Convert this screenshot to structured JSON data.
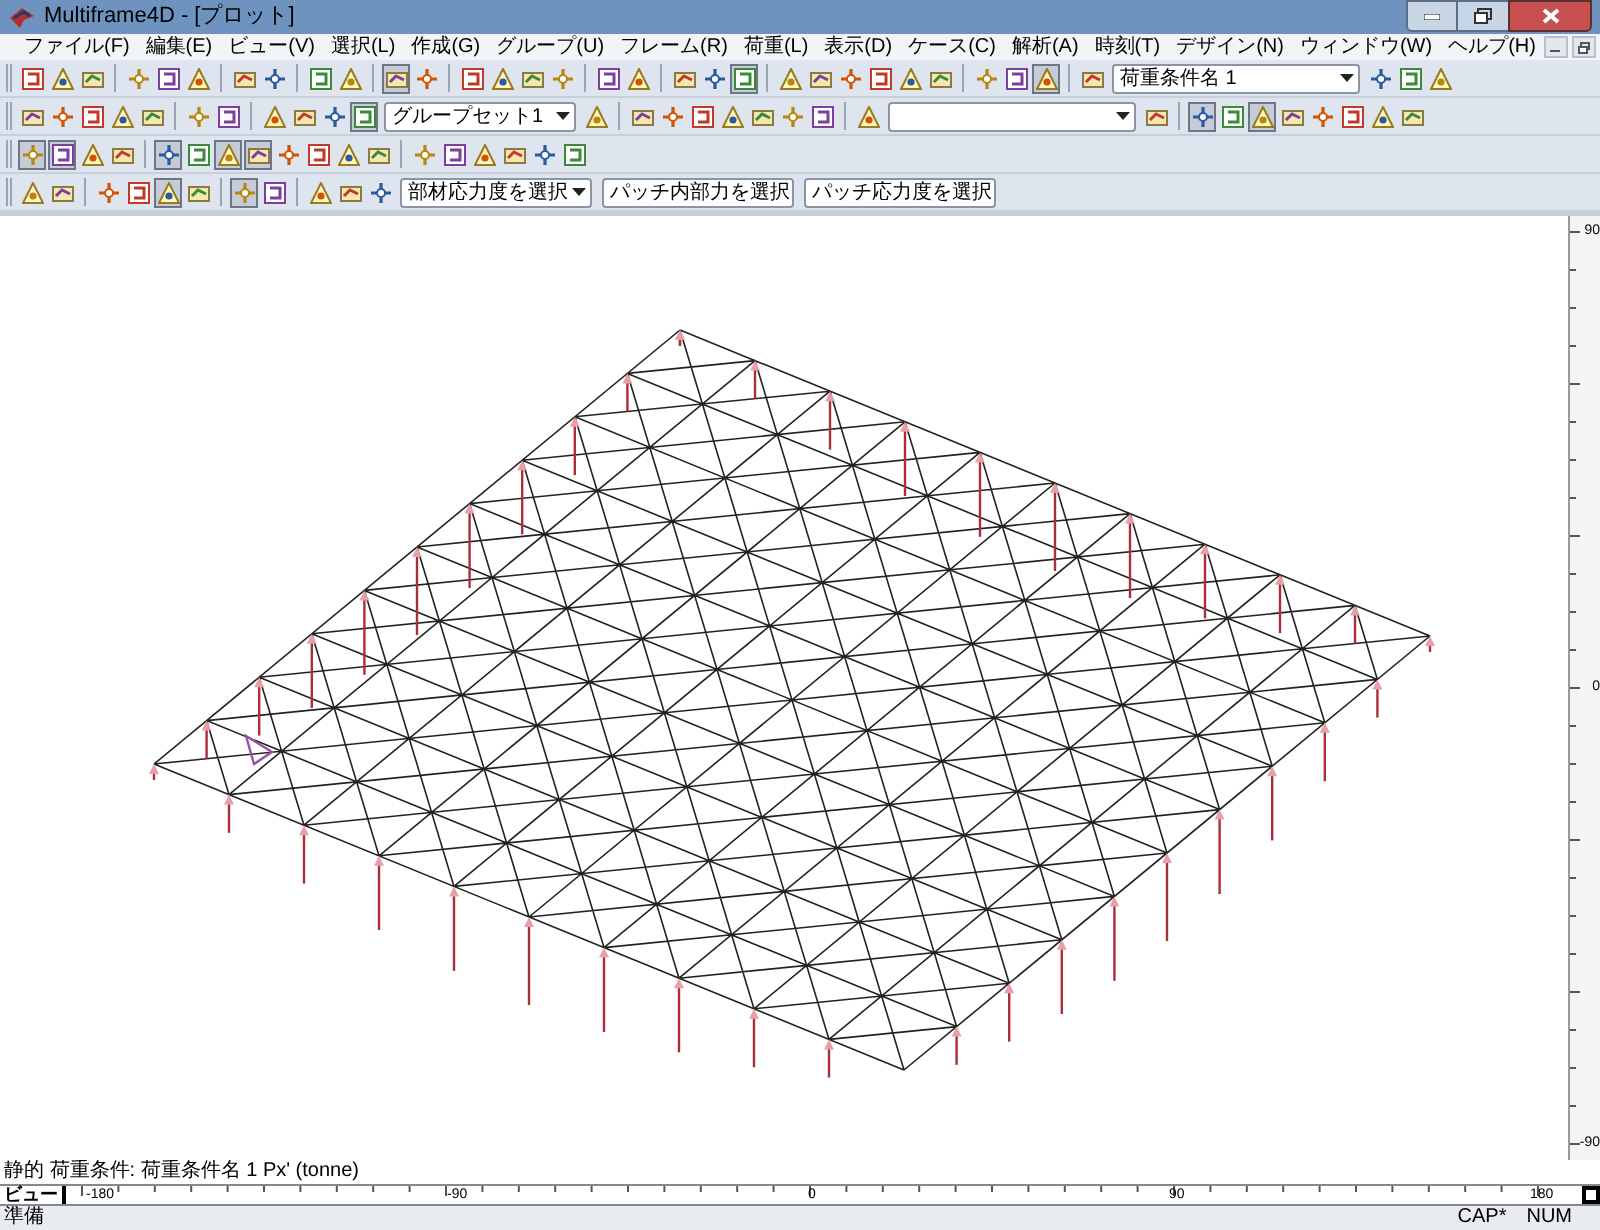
{
  "window": {
    "title": "Multiframe4D - [プロット]"
  },
  "menu": [
    "ファイル(F)",
    "編集(E)",
    "ビュー(V)",
    "選択(L)",
    "作成(G)",
    "グループ(U)",
    "フレーム(R)",
    "荷重(L)",
    "表示(D)",
    "ケース(C)",
    "解析(A)",
    "時刻(T)",
    "デザイン(N)",
    "ウィンドウ(W)",
    "ヘルプ(H)"
  ],
  "toolbars": [
    [
      {
        "kind": "button",
        "pressed": false
      },
      {
        "kind": "button",
        "pressed": false
      },
      {
        "kind": "button",
        "pressed": false
      },
      {
        "kind": "sep"
      },
      {
        "kind": "button",
        "pressed": false
      },
      {
        "kind": "button",
        "pressed": false
      },
      {
        "kind": "button",
        "pressed": false
      },
      {
        "kind": "sep"
      },
      {
        "kind": "button",
        "pressed": false
      },
      {
        "kind": "button",
        "pressed": false
      },
      {
        "kind": "sep"
      },
      {
        "kind": "button",
        "pressed": false
      },
      {
        "kind": "button",
        "pressed": false
      },
      {
        "kind": "sep"
      },
      {
        "kind": "button",
        "pressed": true
      },
      {
        "kind": "button",
        "pressed": false
      },
      {
        "kind": "sep"
      },
      {
        "kind": "button",
        "pressed": false
      },
      {
        "kind": "button",
        "pressed": false
      },
      {
        "kind": "button",
        "pressed": false
      },
      {
        "kind": "button",
        "pressed": false
      },
      {
        "kind": "sep"
      },
      {
        "kind": "button",
        "pressed": false
      },
      {
        "kind": "button",
        "pressed": false
      },
      {
        "kind": "sep"
      },
      {
        "kind": "button",
        "pressed": false
      },
      {
        "kind": "button",
        "pressed": false
      },
      {
        "kind": "button",
        "pressed": true
      },
      {
        "kind": "sep"
      },
      {
        "kind": "button",
        "pressed": false
      },
      {
        "kind": "button",
        "pressed": false
      },
      {
        "kind": "button",
        "pressed": false
      },
      {
        "kind": "button",
        "pressed": false
      },
      {
        "kind": "button",
        "pressed": false
      },
      {
        "kind": "button",
        "pressed": false
      },
      {
        "kind": "sep"
      },
      {
        "kind": "button",
        "pressed": false
      },
      {
        "kind": "button",
        "pressed": false
      },
      {
        "kind": "button",
        "pressed": true
      },
      {
        "kind": "sep"
      },
      {
        "kind": "button",
        "pressed": false
      },
      {
        "kind": "long_combo",
        "value": "荷重条件名 1"
      },
      {
        "kind": "button",
        "pressed": false
      },
      {
        "kind": "button",
        "pressed": false
      },
      {
        "kind": "button",
        "pressed": false
      }
    ],
    [
      {
        "kind": "button",
        "pressed": false
      },
      {
        "kind": "button",
        "pressed": false
      },
      {
        "kind": "button",
        "pressed": false
      },
      {
        "kind": "button",
        "pressed": false
      },
      {
        "kind": "button",
        "pressed": false
      },
      {
        "kind": "sep"
      },
      {
        "kind": "button",
        "pressed": false
      },
      {
        "kind": "button",
        "pressed": false
      },
      {
        "kind": "sep"
      },
      {
        "kind": "button",
        "pressed": false
      },
      {
        "kind": "button",
        "pressed": false
      },
      {
        "kind": "button",
        "pressed": false
      },
      {
        "kind": "button",
        "pressed": true
      },
      {
        "kind": "combo",
        "value": "グループセット1"
      },
      {
        "kind": "button",
        "pressed": false
      },
      {
        "kind": "sep"
      },
      {
        "kind": "button",
        "pressed": false
      },
      {
        "kind": "button",
        "pressed": false
      },
      {
        "kind": "button",
        "pressed": false
      },
      {
        "kind": "button",
        "pressed": false
      },
      {
        "kind": "button",
        "pressed": false
      },
      {
        "kind": "button",
        "pressed": false
      },
      {
        "kind": "button",
        "pressed": false
      },
      {
        "kind": "sep"
      },
      {
        "kind": "button",
        "pressed": false
      },
      {
        "kind": "long_combo"
      },
      {
        "kind": "button",
        "pressed": false
      },
      {
        "kind": "sep"
      },
      {
        "kind": "button",
        "pressed": true
      },
      {
        "kind": "button",
        "pressed": false
      },
      {
        "kind": "button",
        "pressed": true
      },
      {
        "kind": "button",
        "pressed": false
      },
      {
        "kind": "button",
        "pressed": false
      },
      {
        "kind": "button",
        "pressed": false
      },
      {
        "kind": "button",
        "pressed": false
      },
      {
        "kind": "button",
        "pressed": false
      }
    ],
    [
      {
        "kind": "button",
        "pressed": true
      },
      {
        "kind": "button",
        "pressed": true
      },
      {
        "kind": "button",
        "pressed": false
      },
      {
        "kind": "button",
        "pressed": false
      },
      {
        "kind": "sep"
      },
      {
        "kind": "button",
        "pressed": true
      },
      {
        "kind": "button",
        "pressed": false
      },
      {
        "kind": "button",
        "pressed": true
      },
      {
        "kind": "button",
        "pressed": true
      },
      {
        "kind": "button",
        "pressed": false
      },
      {
        "kind": "button",
        "pressed": false
      },
      {
        "kind": "button",
        "pressed": false
      },
      {
        "kind": "button",
        "pressed": false
      },
      {
        "kind": "sep"
      },
      {
        "kind": "button",
        "pressed": false
      },
      {
        "kind": "button",
        "pressed": false
      },
      {
        "kind": "button",
        "pressed": false
      },
      {
        "kind": "button",
        "pressed": false
      },
      {
        "kind": "button",
        "pressed": false
      },
      {
        "kind": "button",
        "pressed": false
      }
    ],
    [
      {
        "kind": "button",
        "pressed": false
      },
      {
        "kind": "button",
        "pressed": false
      },
      {
        "kind": "sep"
      },
      {
        "kind": "button",
        "pressed": false
      },
      {
        "kind": "button",
        "pressed": false
      },
      {
        "kind": "button",
        "pressed": true
      },
      {
        "kind": "button",
        "pressed": false
      },
      {
        "kind": "sep"
      },
      {
        "kind": "button",
        "pressed": true
      },
      {
        "kind": "button",
        "pressed": false
      },
      {
        "kind": "sep"
      },
      {
        "kind": "button",
        "pressed": false
      },
      {
        "kind": "button",
        "pressed": false
      },
      {
        "kind": "button",
        "pressed": false
      },
      {
        "kind": "combo",
        "value": "部材応力度を選択"
      },
      {
        "kind": "combo",
        "value": "パッチ内部力を選択"
      },
      {
        "kind": "combo",
        "value": "パッチ応力度を選択"
      }
    ]
  ],
  "vertical_ruler": [
    "90",
    "0",
    "-90"
  ],
  "horizontal_ruler": {
    "tab": "ビュー",
    "labels": [
      "-180",
      "-90",
      "0",
      "90",
      "180"
    ]
  },
  "status_line": "静的 荷重条件: 荷重条件名 1  Px' (tonne)",
  "status_bar": {
    "text": "準備",
    "indicators": [
      "CAP*",
      "NUM"
    ]
  }
}
